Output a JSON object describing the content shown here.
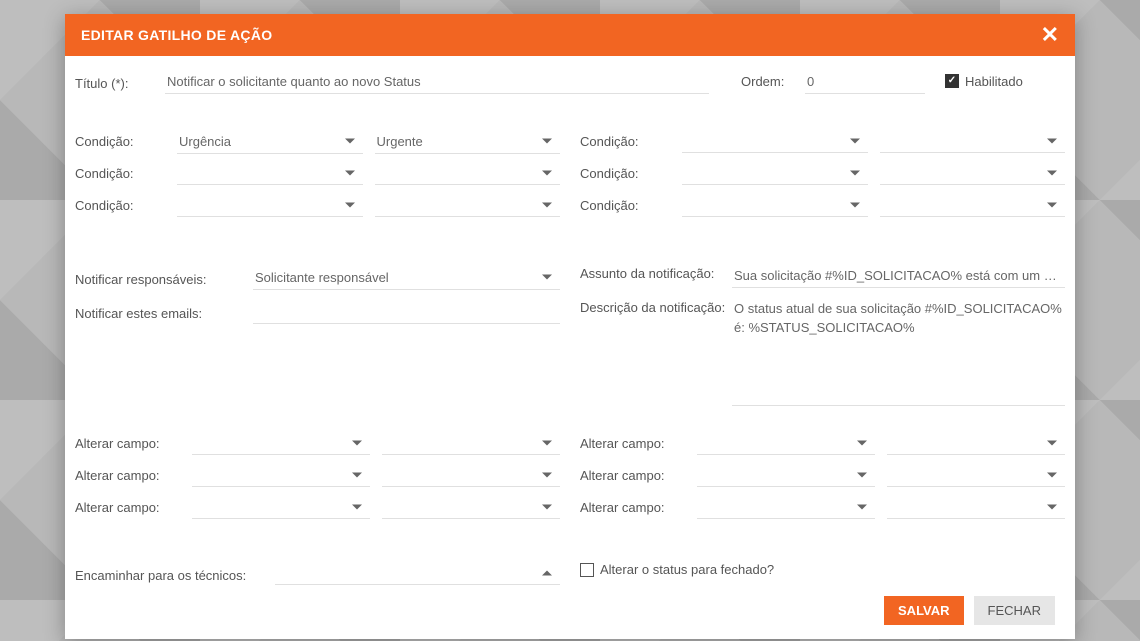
{
  "modal": {
    "title": "EDITAR GATILHO DE AÇÃO",
    "label_titulo": "Título (*):",
    "titulo_value": "Notificar o solicitante quanto ao novo Status",
    "label_ordem": "Ordem:",
    "ordem_value": "0",
    "label_habilitado": "Habilitado",
    "habilitado_checked": true,
    "label_condicao": "Condição:",
    "conditions_left": [
      {
        "field": "Urgência",
        "value": "Urgente"
      },
      {
        "field": "",
        "value": ""
      },
      {
        "field": "",
        "value": ""
      }
    ],
    "conditions_right": [
      {
        "field": "",
        "value": ""
      },
      {
        "field": "",
        "value": ""
      },
      {
        "field": "",
        "value": ""
      }
    ],
    "label_notif_resp": "Notificar responsáveis:",
    "notif_resp_value": "Solicitante responsável",
    "label_notif_emails": "Notificar estes emails:",
    "notif_emails_value": "",
    "label_assunto": "Assunto da notificação:",
    "assunto_value": "Sua solicitação #%ID_SOLICITACAO% está com um novo s",
    "label_descricao": "Descrição da notificação:",
    "descricao_value": "O status atual de sua solicitação #%ID_SOLICITACAO% é: %STATUS_SOLICITACAO%",
    "label_alterar_campo": "Alterar campo:",
    "alter_left": [
      {
        "field": "",
        "value": ""
      },
      {
        "field": "",
        "value": ""
      },
      {
        "field": "",
        "value": ""
      }
    ],
    "alter_right": [
      {
        "field": "",
        "value": ""
      },
      {
        "field": "",
        "value": ""
      },
      {
        "field": "",
        "value": ""
      }
    ],
    "label_encaminhar": "Encaminhar para os técnicos:",
    "encaminhar_value": "",
    "label_alterar_status": "Alterar o status para fechado?",
    "alterar_status_checked": false,
    "btn_salvar": "SALVAR",
    "btn_fechar": "FECHAR"
  }
}
